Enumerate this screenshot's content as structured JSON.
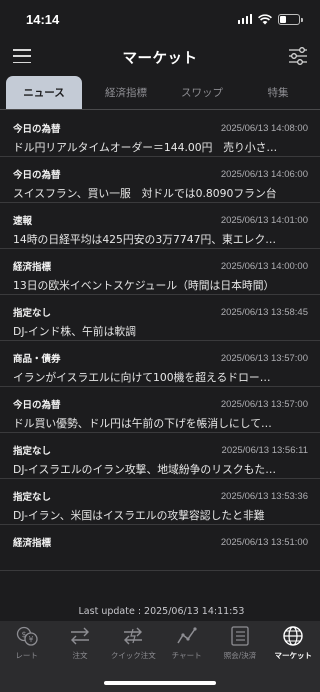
{
  "status_bar": {
    "time": "14:14"
  },
  "header": {
    "title": "マーケット"
  },
  "tabs": [
    {
      "label": "ニュース",
      "active": true
    },
    {
      "label": "経済指標",
      "active": false
    },
    {
      "label": "スワップ",
      "active": false
    },
    {
      "label": "特集",
      "active": false
    }
  ],
  "news": [
    {
      "category": "今日の為替",
      "time": "2025/06/13 14:08:00",
      "headline": "ドル円リアルタイムオーダー＝144.00円　売り小さ…"
    },
    {
      "category": "今日の為替",
      "time": "2025/06/13 14:06:00",
      "headline": "スイスフラン、買い一服　対ドルでは0.8090フラン台"
    },
    {
      "category": "速報",
      "time": "2025/06/13 14:01:00",
      "headline": "14時の日経平均は425円安の3万7747円、東エレク…"
    },
    {
      "category": "経済指標",
      "time": "2025/06/13 14:00:00",
      "headline": "13日の欧米イベントスケジュール（時間は日本時間）"
    },
    {
      "category": "指定なし",
      "time": "2025/06/13 13:58:45",
      "headline": "DJ-インド株、午前は軟調"
    },
    {
      "category": "商品・債券",
      "time": "2025/06/13 13:57:00",
      "headline": "イランがイスラエルに向けて100機を超えるドロー…"
    },
    {
      "category": "今日の為替",
      "time": "2025/06/13 13:57:00",
      "headline": "ドル買い優勢、ドル円は午前の下げを帳消しにして…"
    },
    {
      "category": "指定なし",
      "time": "2025/06/13 13:56:11",
      "headline": "DJ-イスラエルのイラン攻撃、地域紛争のリスクもた…"
    },
    {
      "category": "指定なし",
      "time": "2025/06/13 13:53:36",
      "headline": "DJ-イラン、米国はイスラエルの攻撃容認したと非難"
    },
    {
      "category": "経済指標",
      "time": "2025/06/13 13:51:00",
      "headline": ""
    }
  ],
  "last_update": {
    "label": "Last update :",
    "value": "2025/06/13 14:11:53"
  },
  "bottom_nav": [
    {
      "label": "レート",
      "icon": "rate-icon",
      "active": false
    },
    {
      "label": "注文",
      "icon": "order-icon",
      "active": false
    },
    {
      "label": "クイック注文",
      "icon": "quick-order-icon",
      "active": false
    },
    {
      "label": "チャート",
      "icon": "chart-icon",
      "active": false
    },
    {
      "label": "照会/決済",
      "icon": "inquiry-icon",
      "active": false
    },
    {
      "label": "マーケット",
      "icon": "globe-icon",
      "active": true
    }
  ],
  "colors": {
    "background": "#1c1c1e",
    "active_tab": "#c4cbd6",
    "nav_bar": "#2c2c2e"
  }
}
